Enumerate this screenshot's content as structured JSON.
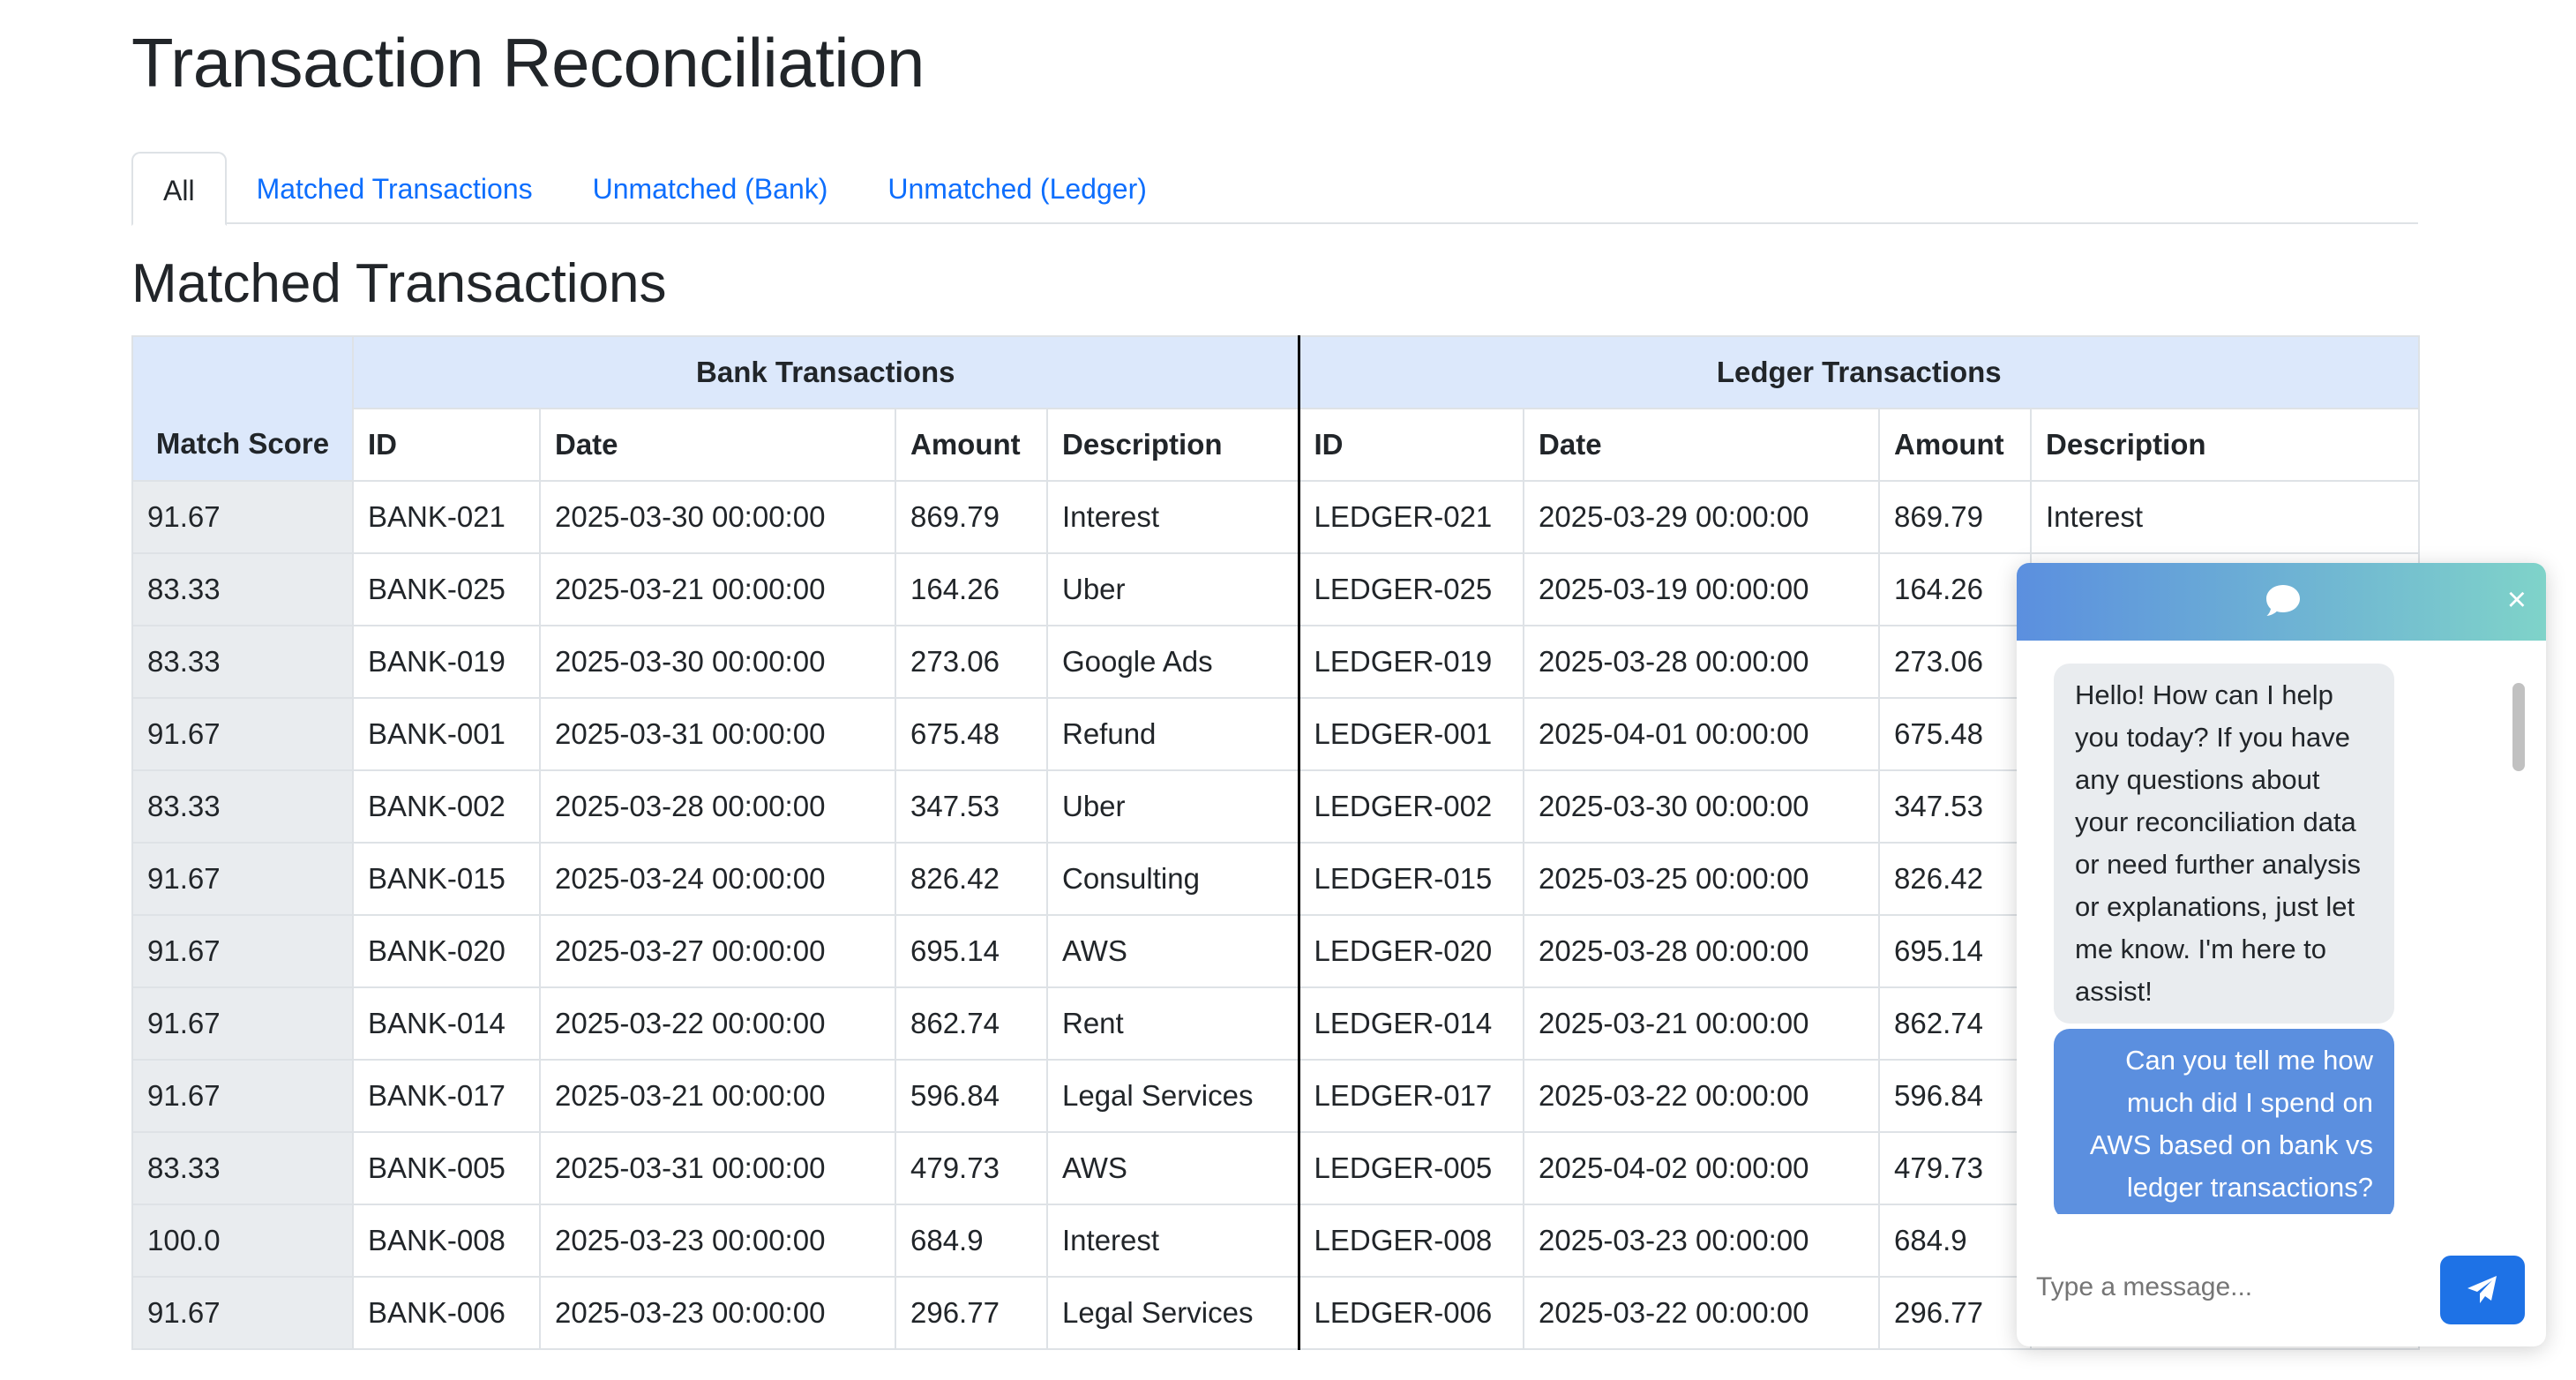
{
  "page": {
    "title": "Transaction Reconciliation"
  },
  "tabs": [
    {
      "label": "All",
      "active": true
    },
    {
      "label": "Matched Transactions",
      "active": false
    },
    {
      "label": "Unmatched (Bank)",
      "active": false
    },
    {
      "label": "Unmatched (Ledger)",
      "active": false
    }
  ],
  "section": {
    "title": "Matched Transactions"
  },
  "table": {
    "groups": {
      "bank": "Bank Transactions",
      "ledger": "Ledger Transactions"
    },
    "columns": {
      "score": "Match Score",
      "bank_id": "ID",
      "bank_date": "Date",
      "bank_amount": "Amount",
      "bank_desc": "Description",
      "ledger_id": "ID",
      "ledger_date": "Date",
      "ledger_amount": "Amount",
      "ledger_desc": "Description"
    },
    "rows": [
      {
        "score": "91.67",
        "bank_id": "BANK-021",
        "bank_date": "2025-03-30 00:00:00",
        "bank_amount": "869.79",
        "bank_desc": "Interest",
        "ledger_id": "LEDGER-021",
        "ledger_date": "2025-03-29 00:00:00",
        "ledger_amount": "869.79",
        "ledger_desc": "Interest"
      },
      {
        "score": "83.33",
        "bank_id": "BANK-025",
        "bank_date": "2025-03-21 00:00:00",
        "bank_amount": "164.26",
        "bank_desc": "Uber",
        "ledger_id": "LEDGER-025",
        "ledger_date": "2025-03-19 00:00:00",
        "ledger_amount": "164.26",
        "ledger_desc": ""
      },
      {
        "score": "83.33",
        "bank_id": "BANK-019",
        "bank_date": "2025-03-30 00:00:00",
        "bank_amount": "273.06",
        "bank_desc": "Google Ads",
        "ledger_id": "LEDGER-019",
        "ledger_date": "2025-03-28 00:00:00",
        "ledger_amount": "273.06",
        "ledger_desc": ""
      },
      {
        "score": "91.67",
        "bank_id": "BANK-001",
        "bank_date": "2025-03-31 00:00:00",
        "bank_amount": "675.48",
        "bank_desc": "Refund",
        "ledger_id": "LEDGER-001",
        "ledger_date": "2025-04-01 00:00:00",
        "ledger_amount": "675.48",
        "ledger_desc": ""
      },
      {
        "score": "83.33",
        "bank_id": "BANK-002",
        "bank_date": "2025-03-28 00:00:00",
        "bank_amount": "347.53",
        "bank_desc": "Uber",
        "ledger_id": "LEDGER-002",
        "ledger_date": "2025-03-30 00:00:00",
        "ledger_amount": "347.53",
        "ledger_desc": ""
      },
      {
        "score": "91.67",
        "bank_id": "BANK-015",
        "bank_date": "2025-03-24 00:00:00",
        "bank_amount": "826.42",
        "bank_desc": "Consulting",
        "ledger_id": "LEDGER-015",
        "ledger_date": "2025-03-25 00:00:00",
        "ledger_amount": "826.42",
        "ledger_desc": ""
      },
      {
        "score": "91.67",
        "bank_id": "BANK-020",
        "bank_date": "2025-03-27 00:00:00",
        "bank_amount": "695.14",
        "bank_desc": "AWS",
        "ledger_id": "LEDGER-020",
        "ledger_date": "2025-03-28 00:00:00",
        "ledger_amount": "695.14",
        "ledger_desc": ""
      },
      {
        "score": "91.67",
        "bank_id": "BANK-014",
        "bank_date": "2025-03-22 00:00:00",
        "bank_amount": "862.74",
        "bank_desc": "Rent",
        "ledger_id": "LEDGER-014",
        "ledger_date": "2025-03-21 00:00:00",
        "ledger_amount": "862.74",
        "ledger_desc": ""
      },
      {
        "score": "91.67",
        "bank_id": "BANK-017",
        "bank_date": "2025-03-21 00:00:00",
        "bank_amount": "596.84",
        "bank_desc": "Legal Services",
        "ledger_id": "LEDGER-017",
        "ledger_date": "2025-03-22 00:00:00",
        "ledger_amount": "596.84",
        "ledger_desc": ""
      },
      {
        "score": "83.33",
        "bank_id": "BANK-005",
        "bank_date": "2025-03-31 00:00:00",
        "bank_amount": "479.73",
        "bank_desc": "AWS",
        "ledger_id": "LEDGER-005",
        "ledger_date": "2025-04-02 00:00:00",
        "ledger_amount": "479.73",
        "ledger_desc": ""
      },
      {
        "score": "100.0",
        "bank_id": "BANK-008",
        "bank_date": "2025-03-23 00:00:00",
        "bank_amount": "684.9",
        "bank_desc": "Interest",
        "ledger_id": "LEDGER-008",
        "ledger_date": "2025-03-23 00:00:00",
        "ledger_amount": "684.9",
        "ledger_desc": ""
      },
      {
        "score": "91.67",
        "bank_id": "BANK-006",
        "bank_date": "2025-03-23 00:00:00",
        "bank_amount": "296.77",
        "bank_desc": "Legal Services",
        "ledger_id": "LEDGER-006",
        "ledger_date": "2025-03-22 00:00:00",
        "ledger_amount": "296.77",
        "ledger_desc": ""
      }
    ]
  },
  "chat": {
    "header_icon": "chat-bubble-icon",
    "close_label": "×",
    "messages": [
      {
        "role": "bot",
        "text": "Hello! How can I help you today? If you have any questions about your reconciliation data or need further analysis or explanations, just let me know. I'm here to assist!"
      },
      {
        "role": "user",
        "text": "Can you tell me how much did I spend on AWS based on bank vs ledger transactions?"
      }
    ],
    "input_placeholder": "Type a message...",
    "send_icon": "paper-plane-icon"
  },
  "colors": {
    "accent": "#0d6efd",
    "group_header_bg": "#dce8fb",
    "score_bg": "#e9ecef",
    "user_bubble": "#5b8fdf",
    "send_button": "#1e72e6"
  }
}
